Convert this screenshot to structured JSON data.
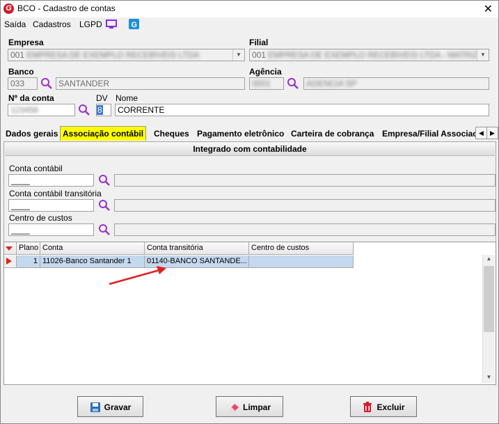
{
  "window": {
    "title": "BCO - Cadastro de contas",
    "app_logo": "G"
  },
  "menu": {
    "items": [
      "Saída",
      "Cadastros",
      "LGPD"
    ]
  },
  "form": {
    "empresa_label": "Empresa",
    "empresa_code": "001",
    "empresa_name": "EMPRESA DE EXEMPLO RECEBIVEIS LTDA",
    "filial_label": "Filial",
    "filial_code": "001",
    "filial_name": "EMPRESA DE EXEMPLO RECEBIVEIS LTDA - MATRIZ",
    "banco_label": "Banco",
    "banco_code": "033",
    "banco_name": "SANTANDER",
    "agencia_label": "Agência",
    "agencia_code": "0001",
    "agencia_name": "AGENCIA SP",
    "conta_label": "Nº da conta",
    "conta_value": "123456",
    "dv_label": "DV",
    "dv_value": "8",
    "nome_label": "Nome",
    "nome_value": "CORRENTE"
  },
  "tabs": [
    "Dados gerais",
    "Associação contábil",
    "Cheques",
    "Pagamento eletrônico",
    "Carteira de cobrança",
    "Empresa/Filial Associac"
  ],
  "panel": {
    "header": "Integrado com contabilidade",
    "conta_contabil_label": "Conta contábil",
    "conta_contabil_value": "____",
    "conta_transitoria_label": "Conta contábil transitória",
    "conta_transitoria_value": "____",
    "centro_custos_label": "Centro de custos",
    "centro_custos_value": "____"
  },
  "grid": {
    "columns": [
      "Plano",
      "Conta",
      "Conta transitória",
      "Centro de custos"
    ],
    "rows": [
      {
        "plano": "1",
        "conta": "11026-Banco Santander 1",
        "conta_transitoria": "01140-BANCO SANTANDE...",
        "centro_custos": ""
      }
    ]
  },
  "buttons": {
    "gravar": "Gravar",
    "limpar": "Limpar",
    "excluir": "Excluir"
  },
  "colors": {
    "active_tab": "#ffff00",
    "selected_row": "#c4d8ee",
    "arrow": "#e02020",
    "search_icon": "#9b30c8"
  }
}
